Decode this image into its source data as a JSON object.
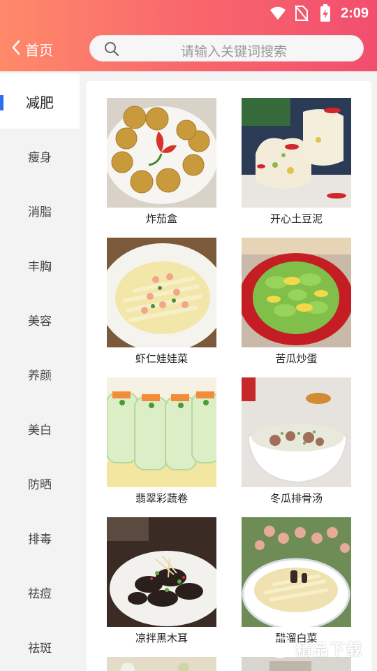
{
  "status_bar": {
    "time": "2:09",
    "icons": [
      "wifi-icon",
      "no-sim-icon",
      "battery-charging-icon"
    ]
  },
  "header": {
    "back_label": "首页",
    "search_placeholder": "请输入关键词搜索"
  },
  "colors": {
    "header_gradient_start": "#ff8a6a",
    "header_gradient_end": "#f24e6e",
    "active_indicator": "#2f6df6"
  },
  "sidebar": {
    "items": [
      {
        "label": "减肥",
        "active": true
      },
      {
        "label": "瘦身"
      },
      {
        "label": "消脂"
      },
      {
        "label": "丰胸"
      },
      {
        "label": "美容"
      },
      {
        "label": "养颜"
      },
      {
        "label": "美白"
      },
      {
        "label": "防晒"
      },
      {
        "label": "排毒"
      },
      {
        "label": "祛痘"
      },
      {
        "label": "祛斑"
      }
    ]
  },
  "recipes": [
    {
      "name": "炸茄盒"
    },
    {
      "name": "开心土豆泥"
    },
    {
      "name": "虾仁娃娃菜"
    },
    {
      "name": "苦瓜炒蛋"
    },
    {
      "name": "翡翠彩蔬卷"
    },
    {
      "name": "冬瓜排骨汤"
    },
    {
      "name": "凉拌黑木耳"
    },
    {
      "name": "醋溜白菜"
    }
  ],
  "watermark": {
    "text": "精品下载"
  }
}
